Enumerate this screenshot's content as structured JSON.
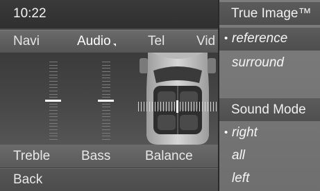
{
  "status": {
    "time": "10:22"
  },
  "menu": {
    "items": [
      {
        "label": "Navi"
      },
      {
        "label": "Audio"
      },
      {
        "label": "Tel"
      },
      {
        "label": "Vid"
      }
    ],
    "active": "Audio"
  },
  "controls": {
    "treble_label": "Treble",
    "bass_label": "Bass",
    "balance_label": "Balance",
    "treble_level": 0,
    "bass_level": 0,
    "balance_level": 0
  },
  "footer": {
    "back_label": "Back"
  },
  "sidebar": {
    "true_image": {
      "title": "True Image™",
      "options": [
        "reference",
        "surround"
      ],
      "selected": "reference"
    },
    "sound_mode": {
      "title": "Sound Mode",
      "options": [
        "right",
        "all",
        "left"
      ],
      "selected": "right"
    }
  },
  "colors": {
    "marker": "#ffffff",
    "panel": "#4a4a4a",
    "highlight": "#5c5c5c"
  }
}
